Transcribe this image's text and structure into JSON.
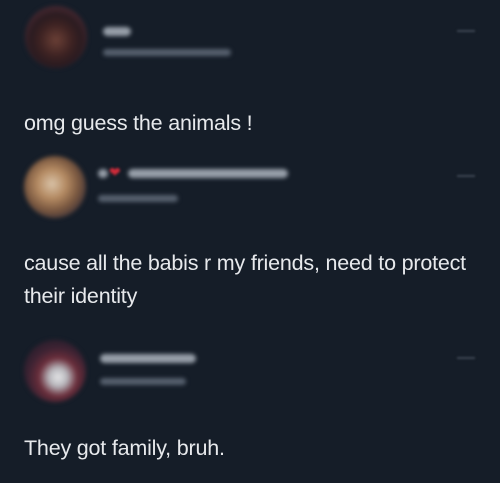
{
  "tweets": [
    {
      "text": "omg guess the animals !"
    },
    {
      "text": "cause all the babis r my friends, need to protect their identity"
    },
    {
      "text": "They got family, bruh."
    }
  ],
  "colors": {
    "background": "#151d28",
    "text": "#e7e9ec",
    "heart": "#d22b3a"
  },
  "icons": [
    "more-options-icon",
    "heart-icon"
  ]
}
